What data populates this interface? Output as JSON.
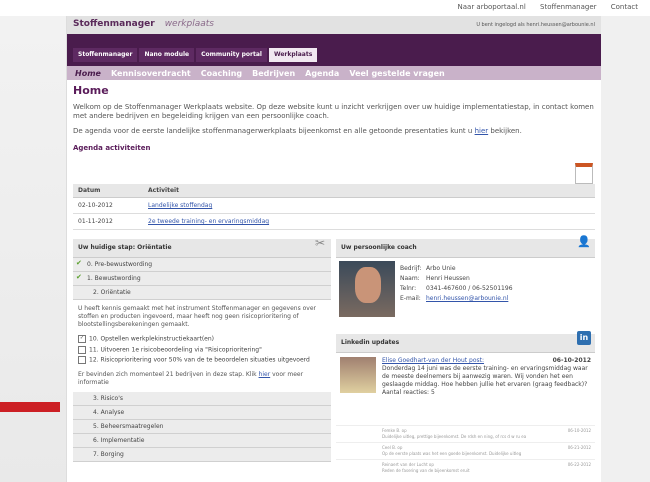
{
  "top_links": [
    "Naar arboportaal.nl",
    "Stoffenmanager",
    "Contact"
  ],
  "logo": {
    "name": "Stoffenmanager",
    "sub": "werkplaats"
  },
  "logged_in": "U bent ingelogd als henri.heussen@arbounie.nl",
  "tabs": [
    {
      "label": "Stoffenmanager",
      "active": false
    },
    {
      "label": "Nano module",
      "active": false
    },
    {
      "label": "Community portal",
      "active": false
    },
    {
      "label": "Werkplaats",
      "active": true
    }
  ],
  "subnav": [
    {
      "label": "Home",
      "active": true
    },
    {
      "label": "Kennisoverdracht",
      "active": false
    },
    {
      "label": "Coaching",
      "active": false
    },
    {
      "label": "Bedrijven",
      "active": false
    },
    {
      "label": "Agenda",
      "active": false
    },
    {
      "label": "Veel gestelde vragen",
      "active": false
    }
  ],
  "main": {
    "title": "Home",
    "intro": "Welkom op de Stoffenmanager Werkplaats website. Op deze website kunt u inzicht verkrijgen over uw huidige implementatiestap, in contact komen met andere bedrijven en begeleiding krijgen van een persoonlijke coach.",
    "intro2_pre": "De agenda voor de eerste landelijke stoffenmanagerwerkplaats bijeenkomst en alle getoonde presentaties kunt u ",
    "intro2_link": "hier",
    "intro2_post": " bekijken."
  },
  "agenda": {
    "title": "Agenda activiteiten",
    "headers": [
      "Datum",
      "Activiteit"
    ],
    "rows": [
      {
        "date": "02-10-2012",
        "activity": "Landelijke stoffendag"
      },
      {
        "date": "01-11-2012",
        "activity": "2e tweede training- en ervaringsmiddag"
      }
    ]
  },
  "step": {
    "title": "Uw huidige stap: Oriëntatie",
    "items": [
      {
        "label": "0. Pre-bewustwording",
        "done": true
      },
      {
        "label": "1. Bewustwording",
        "done": true
      },
      {
        "label": "2. Oriëntatie",
        "done": false
      }
    ],
    "desc": "U heeft kennis gemaakt met het instrument Stoffenmanager en gegevens over stoffen en producten ingevoerd, maar heeft nog geen risicoprioritering of blootstellingsberekeningen gemaakt.",
    "checks": [
      {
        "label": "10. Opstellen werkplekinstructiekaart(en)",
        "checked": true
      },
      {
        "label": "11. Uitvoeren 1e risicobeoordeling via \"Risicoprioritering\"",
        "checked": false
      },
      {
        "label": "12. Risicoprioritering voor 50% van de te beoordelen situaties uitgevoerd",
        "checked": false
      }
    ],
    "note_pre": "Er bevinden zich momenteel 21 bedrijven in deze stap. Klik ",
    "note_link": "hier",
    "note_post": " voor meer informatie",
    "later": [
      "3. Risico's",
      "4. Analyse",
      "5. Beheersmaatregelen",
      "6. Implementatie",
      "7. Borging"
    ]
  },
  "coach": {
    "title": "Uw persoonlijke coach",
    "fields": [
      {
        "label": "Bedrijf:",
        "value": "Arbo Unie"
      },
      {
        "label": "Naam:",
        "value": "Henri Heussen"
      },
      {
        "label": "Telnr:",
        "value": "0341-467600 / 06-52501196"
      },
      {
        "label": "E-mail:",
        "value": "henri.heussen@arbounie.nl"
      }
    ]
  },
  "linkedin": {
    "title": "Linkedin updates",
    "icon_text": "in",
    "main_author": "Elise Goedhart-van der Hout post:",
    "main_date": "06-10-2012",
    "main_text": "Donderdag 14 juni was de eerste training- en ervaringsmiddag waar de meeste deelnemers bij aanwezig waren. Wij vonden het een geslaagde middag. Hoe hebben jullie het ervaren (graag feedback)?",
    "main_reactions": "Aantal reacties: 5",
    "replies": [
      {
        "name": "Femke B. op",
        "date": "06-10-2012",
        "text": "Duidelijke uitleg, prettige bijeenkomst. De rdsh en ning, of rcs d w ru ea"
      },
      {
        "name": "Ceel B. op",
        "date": "06-21-2012",
        "text": "Op de eerste plaats was het een goede bijeenkomst. Duidelijke uitleg"
      },
      {
        "name": "Reinaert van der Lucht op",
        "date": "06-22-2012",
        "text": "Reden de fasering van de bijeenkomst eruit"
      }
    ]
  },
  "colors": {
    "brand_purple": "#4a1c4d",
    "subnav": "#c9b2c9",
    "accent_red": "#cc1f24",
    "linkedin": "#2e6fb0"
  }
}
